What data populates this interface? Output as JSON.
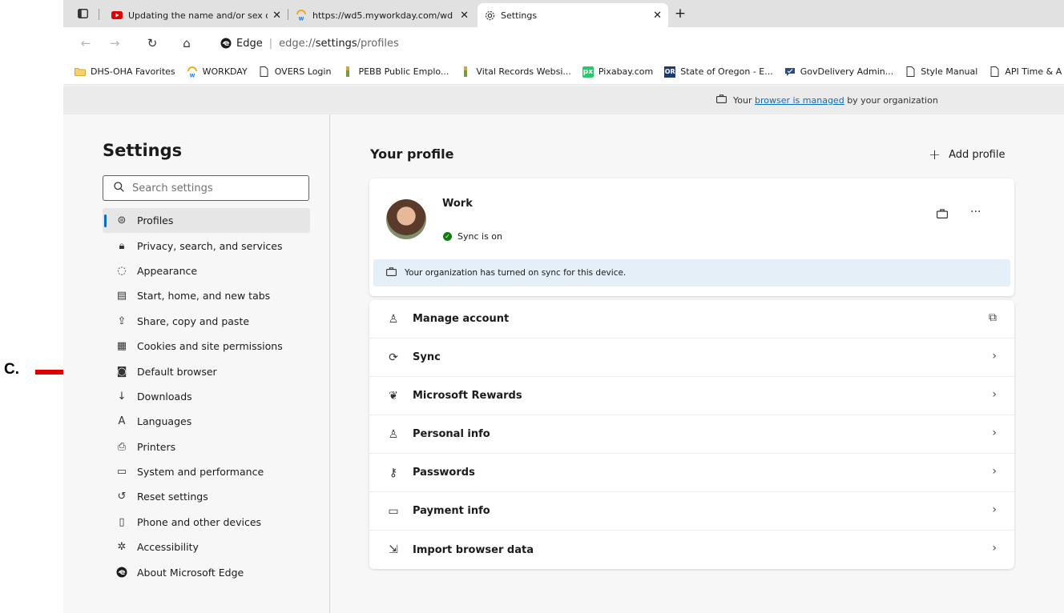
{
  "tabs": [
    {
      "title": "Updating the name and/or sex o",
      "close": "✕",
      "active": false
    },
    {
      "title": "https://wd5.myworkday.com/wd",
      "close": "✕",
      "active": false
    },
    {
      "title": "Settings",
      "close": "✕",
      "active": true
    }
  ],
  "new_tab_symbol": "+",
  "address": {
    "brand": "Edge",
    "url_prefix": "edge://",
    "url_bold": "settings",
    "url_suffix": "/profiles"
  },
  "favorites": [
    {
      "label": "DHS-OHA Favorites",
      "icon": "folder-icon"
    },
    {
      "label": "WORKDAY",
      "icon": "workday-icon"
    },
    {
      "label": "OVERS Login",
      "icon": "page-icon"
    },
    {
      "label": "PEBB Public Emplo...",
      "icon": "pebb-icon"
    },
    {
      "label": "Vital Records Websi...",
      "icon": "pebb-icon"
    },
    {
      "label": "Pixabay.com",
      "icon": "pixabay-icon"
    },
    {
      "label": "State of Oregon - E...",
      "icon": "oregon-icon"
    },
    {
      "label": "GovDelivery Admin...",
      "icon": "govdelivery-icon"
    },
    {
      "label": "Style Manual",
      "icon": "page-icon"
    },
    {
      "label": "API Time & A",
      "icon": "page-icon"
    }
  ],
  "managed": {
    "prefix": "Your",
    "link": "browser is managed",
    "suffix": "by your organization"
  },
  "sidebar": {
    "title": "Settings",
    "search_placeholder": "Search settings",
    "items": [
      {
        "label": "Profiles",
        "icon": "profile-icon",
        "glyph": "⊜",
        "selected": true
      },
      {
        "label": "Privacy, search, and services",
        "icon": "lock-icon",
        "glyph": "🔒︎",
        "selected": false
      },
      {
        "label": "Appearance",
        "icon": "appearance-icon",
        "glyph": "◌",
        "selected": false
      },
      {
        "label": "Start, home, and new tabs",
        "icon": "start-home-icon",
        "glyph": "▤",
        "selected": false
      },
      {
        "label": "Share, copy and paste",
        "icon": "share-icon",
        "glyph": "⇪",
        "selected": false
      },
      {
        "label": "Cookies and site permissions",
        "icon": "cookies-icon",
        "glyph": "▦",
        "selected": false
      },
      {
        "label": "Default browser",
        "icon": "default-browser-icon",
        "glyph": "◙",
        "selected": false
      },
      {
        "label": "Downloads",
        "icon": "download-icon",
        "glyph": "↓",
        "selected": false
      },
      {
        "label": "Languages",
        "icon": "languages-icon",
        "glyph": "A",
        "selected": false
      },
      {
        "label": "Printers",
        "icon": "printer-icon",
        "glyph": "⎙",
        "selected": false
      },
      {
        "label": "System and performance",
        "icon": "system-icon",
        "glyph": "▭",
        "selected": false
      },
      {
        "label": "Reset settings",
        "icon": "reset-icon",
        "glyph": "↺",
        "selected": false
      },
      {
        "label": "Phone and other devices",
        "icon": "phone-icon",
        "glyph": "▯",
        "selected": false
      },
      {
        "label": "Accessibility",
        "icon": "accessibility-icon",
        "glyph": "✲",
        "selected": false
      },
      {
        "label": "About Microsoft Edge",
        "icon": "edge-icon",
        "glyph": "●",
        "selected": false
      }
    ]
  },
  "main": {
    "heading": "Your profile",
    "add_profile": "Add profile",
    "profile": {
      "name": "Work",
      "sync_status": "Sync is on",
      "banner": "Your organization has turned on sync for this device.",
      "more": "···"
    },
    "rows": [
      {
        "label": "Manage account",
        "icon": "person-icon",
        "glyph": "♙",
        "trail": "⧉",
        "trail_icon": "external-link-icon"
      },
      {
        "label": "Sync",
        "icon": "sync-icon",
        "glyph": "⟳",
        "trail": "›",
        "trail_icon": "chevron-right-icon"
      },
      {
        "label": "Microsoft Rewards",
        "icon": "rewards-icon",
        "glyph": "❦",
        "trail": "›",
        "trail_icon": "chevron-right-icon"
      },
      {
        "label": "Personal info",
        "icon": "personal-info-icon",
        "glyph": "♙",
        "trail": "›",
        "trail_icon": "chevron-right-icon"
      },
      {
        "label": "Passwords",
        "icon": "key-icon",
        "glyph": "⚷",
        "trail": "›",
        "trail_icon": "chevron-right-icon"
      },
      {
        "label": "Payment info",
        "icon": "card-icon",
        "glyph": "▭",
        "trail": "›",
        "trail_icon": "chevron-right-icon"
      },
      {
        "label": "Import browser data",
        "icon": "import-icon",
        "glyph": "⇲",
        "trail": "›",
        "trail_icon": "chevron-right-icon"
      }
    ]
  },
  "annotation": {
    "label": "C.",
    "color": "#e00000"
  },
  "colors": {
    "accent": "#0f6cbd",
    "sync_green": "#107c10",
    "banner_bg": "#e5eff7"
  }
}
